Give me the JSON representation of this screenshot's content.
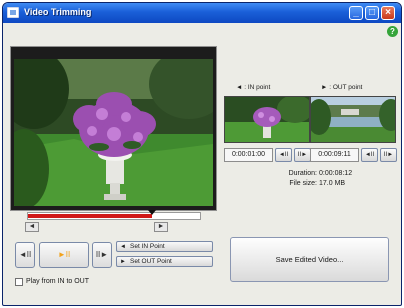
{
  "window": {
    "title": "Video Trimming",
    "minimize_glyph": "_",
    "maximize_glyph": "□",
    "close_glyph": "×",
    "help_glyph": "?"
  },
  "player": {
    "play_pause_glyph": "►II",
    "prev_glyph": "◄II",
    "next_glyph": "II►",
    "timeline_progress": 0.72,
    "in_marker_glyph": "◄",
    "out_marker_glyph": "►"
  },
  "buttons": {
    "set_in_point": "Set IN Point",
    "set_out_point": "Set OUT Point",
    "save_edited_video": "Save Edited Video..."
  },
  "options": {
    "play_from_in_to_out": "Play from IN to OUT",
    "play_from_in_to_out_checked": false
  },
  "in_point": {
    "label": ": IN point",
    "marker_glyph": "◄",
    "time": "0:00:01:00"
  },
  "out_point": {
    "label": ": OUT point",
    "marker_glyph": "►",
    "time": "0:00:09:11"
  },
  "step_buttons": {
    "prev_frame": "◄II",
    "next_frame": "II►"
  },
  "info": {
    "duration_label": "Duration:",
    "duration_value": "0:00:08:12",
    "file_size_label": "File size:",
    "file_size_value": "17.0 MB"
  },
  "colors": {
    "title_bar": "#1a5fd8",
    "timeline_fill": "#d01818",
    "help_icon": "#35a43a"
  }
}
